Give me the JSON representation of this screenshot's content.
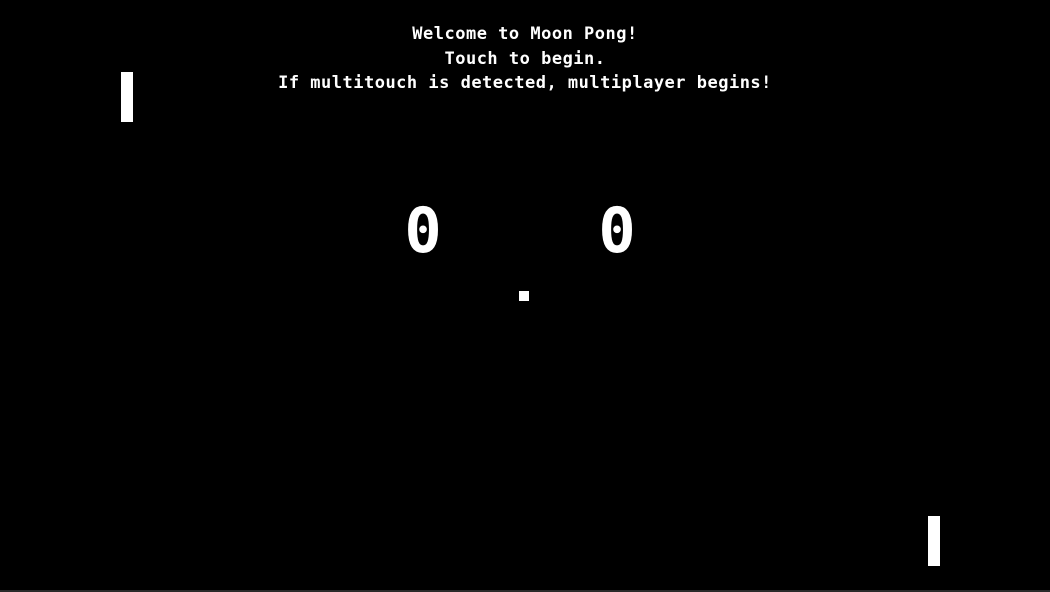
{
  "intro": {
    "line1": "Welcome to Moon Pong!",
    "line2": "Touch to begin.",
    "line3": "If multitouch is detected, multiplayer begins!"
  },
  "score": {
    "left": "0",
    "right": "0"
  },
  "colors": {
    "background": "#000000",
    "foreground": "#ffffff"
  }
}
